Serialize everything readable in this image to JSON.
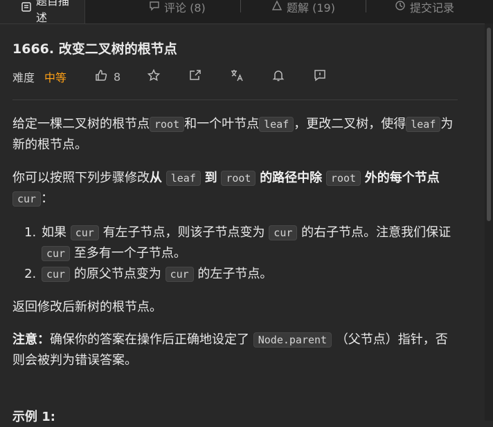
{
  "tabs": [
    {
      "label": "题目描述"
    },
    {
      "label": "评论 (8)"
    },
    {
      "label": "题解 (19)"
    },
    {
      "label": "提交记录"
    }
  ],
  "problem": {
    "title": "1666. 改变二叉树的根节点",
    "difficulty_label": "难度",
    "difficulty": "中等",
    "likes": "8",
    "colors": {
      "difficulty": "#ffa116"
    }
  },
  "description": {
    "p1": {
      "t1": "给定一棵二叉树的根节点",
      "c1": "root",
      "t2": "和一个叶节点",
      "c2": "leaf",
      "t3": "，更改二叉树，使得",
      "c3": "leaf",
      "t4": "为新的根节点。"
    },
    "p2": {
      "t1": "你可以按照下列步骤修改",
      "b1": "从",
      "c1": "leaf",
      "b2": "到",
      "c2": "root",
      "b3": "的路径中除",
      "c3": "root",
      "b4": "外的每个节点",
      "c4": "cur",
      "t2": "："
    },
    "steps": [
      {
        "t1": "如果",
        "c1": "cur",
        "t2": "有左子节点，则该子节点变为",
        "c2": "cur",
        "t3": "的右子节点。注意我们保证",
        "c3": "cur",
        "t4": "至多有一个子节点。"
      },
      {
        "c1": "cur",
        "t1": "的原父节点变为",
        "c2": "cur",
        "t2": "的左子节点。"
      }
    ],
    "p3": "返回修改后新树的根节点。",
    "note": {
      "label": "注意：",
      "t1": "确保你的答案在操作后正确地设定了",
      "c1": "Node.parent",
      "t2": "（父节点）指针，否则会被判为错误答案。"
    },
    "example_heading": "示例 1:"
  }
}
